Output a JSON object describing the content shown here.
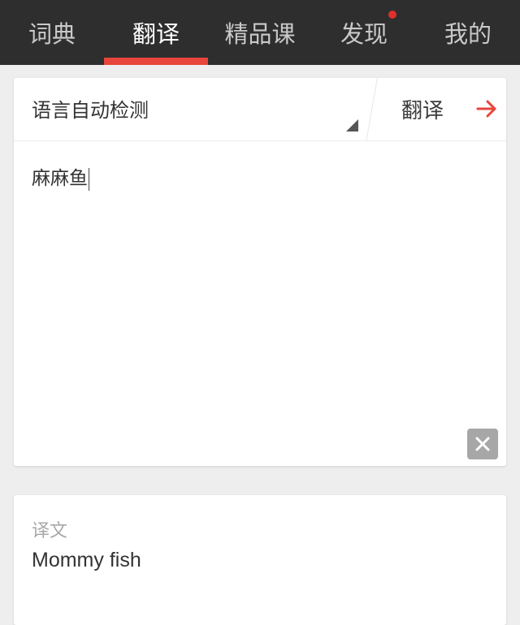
{
  "tabs": [
    {
      "label": "词典",
      "active": false
    },
    {
      "label": "翻译",
      "active": true
    },
    {
      "label": "精品课",
      "active": false
    },
    {
      "label": "发现",
      "active": false,
      "has_notification_dot": true
    },
    {
      "label": "我的",
      "active": false
    }
  ],
  "colors": {
    "topbar_bg": "#2e2e2e",
    "accent": "#e8453c",
    "page_bg": "#efeeee"
  },
  "input_card": {
    "language_select": "语言自动检测",
    "translate_button": "翻译",
    "source_text": "麻麻鱼"
  },
  "result_card": {
    "label": "译文",
    "text": "Mommy fish"
  },
  "icons": {
    "translate_arrow": "arrow-right-icon",
    "clear": "close-icon",
    "language_dropdown": "dropdown-triangle-icon",
    "notification": "notification-dot-icon"
  }
}
